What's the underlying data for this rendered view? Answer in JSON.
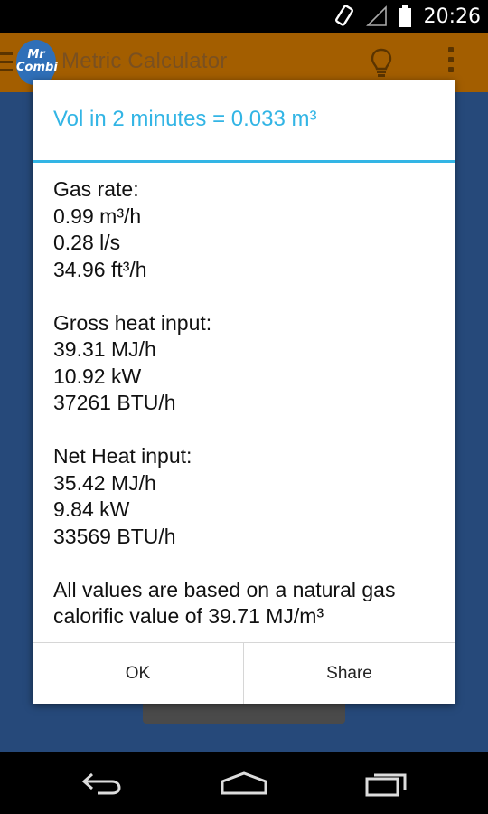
{
  "status_bar": {
    "time": "20:26",
    "icons": [
      "screen-rotation-icon",
      "signal-icon",
      "battery-icon"
    ]
  },
  "app": {
    "logo_text": "Mr Combi",
    "title": "Metric Calculator",
    "action_icons": [
      "bulb-icon",
      "overflow-menu-icon"
    ]
  },
  "dialog": {
    "title": "Vol in 2 minutes = 0.033 m³",
    "gas_rate": {
      "heading": "Gas rate:",
      "values": [
        "0.99 m³/h",
        "0.28 l/s",
        "34.96 ft³/h"
      ]
    },
    "gross_heat": {
      "heading": "Gross heat input:",
      "values": [
        "39.31 MJ/h",
        "10.92 kW",
        "37261 BTU/h"
      ]
    },
    "net_heat": {
      "heading": "Net Heat input:",
      "values": [
        "35.42 MJ/h",
        "9.84 kW",
        "33569 BTU/h"
      ]
    },
    "note_line1": "All values are based on a natural gas",
    "note_line2": "calorific value of 39.71 MJ/m³",
    "ok_label": "OK",
    "share_label": "Share"
  },
  "nav_bar": {
    "icons": [
      "back-icon",
      "home-icon",
      "recent-apps-icon"
    ]
  },
  "colors": {
    "accent": "#33b5e5",
    "action_bar": "#a35e00",
    "app_background": "#26497a"
  }
}
